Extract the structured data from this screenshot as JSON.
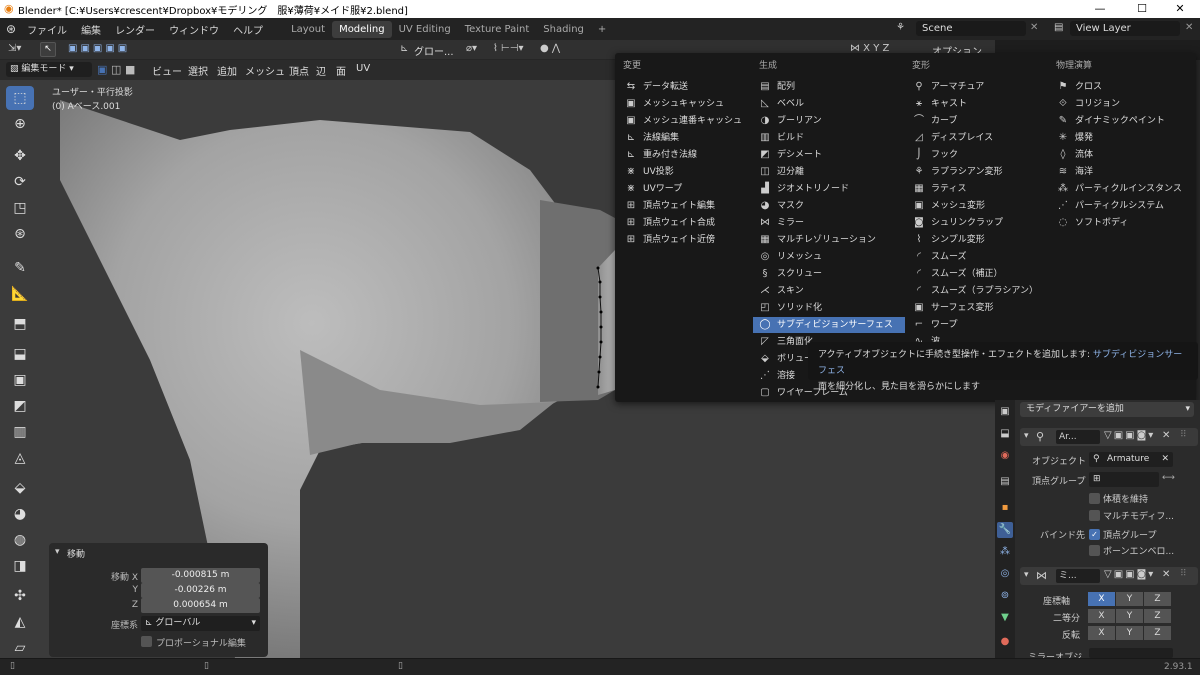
{
  "window": {
    "title": "Blender* [C:¥Users¥crescent¥Dropbox¥モデリング　服¥薄荷¥メイド服¥2.blend]",
    "minimize": "—",
    "maximize": "☐",
    "close": "✕"
  },
  "topbar": {
    "menus": [
      "ファイル",
      "編集",
      "レンダー",
      "ウィンドウ",
      "ヘルプ"
    ],
    "workspaces": [
      "Layout",
      "Modeling",
      "UV Editing",
      "Texture Paint",
      "Shading"
    ],
    "add_workspace": "+",
    "scene": "Scene",
    "view_layer": "View Layer"
  },
  "header": {
    "transform_orientation": "グロー...",
    "pivot_label": "オプション",
    "mode": "編集モード",
    "menus": [
      "ビュー",
      "選択",
      "追加",
      "メッシュ",
      "頂点",
      "辺",
      "面",
      "UV"
    ]
  },
  "viewport": {
    "view_name": "ユーザー・平行投影",
    "object_name": "(0) Aベース.001"
  },
  "move_panel": {
    "title": "移動",
    "x_label": "移動 X",
    "x_value": "-0.000815 m",
    "y_label": "Y",
    "y_value": "-0.00226 m",
    "z_label": "Z",
    "z_value": "0.000654 m",
    "coord_label": "座標系",
    "coord_value": "グローバル",
    "proportional_label": "プロポーショナル編集"
  },
  "add_menu": {
    "columns": [
      {
        "header": "変更",
        "items": [
          "データ転送",
          "メッシュキャッシュ",
          "メッシュ連番キャッシュ",
          "法線編集",
          "重み付き法線",
          "UV投影",
          "UVワープ",
          "頂点ウェイト編集",
          "頂点ウェイト合成",
          "頂点ウェイト近傍"
        ]
      },
      {
        "header": "生成",
        "items": [
          "配列",
          "ベベル",
          "ブーリアン",
          "ビルド",
          "デシメート",
          "辺分離",
          "ジオメトリノード",
          "マスク",
          "ミラー",
          "マルチレゾリューション",
          "リメッシュ",
          "スクリュー",
          "スキン",
          "ソリッド化",
          "サブディビジョンサーフェス",
          "三角面化",
          "ボリュー",
          "溶接",
          "ワイヤーフレーム"
        ]
      },
      {
        "header": "変形",
        "items": [
          "アーマチュア",
          "キャスト",
          "カーブ",
          "ディスプレイス",
          "フック",
          "ラプラシアン変形",
          "ラティス",
          "メッシュ変形",
          "シュリンクラップ",
          "シンプル変形",
          "スムーズ",
          "スムーズ（補正）",
          "スムーズ（ラプラシアン）",
          "サーフェス変形",
          "ワープ",
          "波"
        ]
      },
      {
        "header": "物理演算",
        "items": [
          "クロス",
          "コリジョン",
          "ダイナミックペイント",
          "爆発",
          "流体",
          "海洋",
          "パーティクルインスタンス",
          "パーティクルシステム",
          "ソフトボディ"
        ]
      }
    ],
    "highlighted": "サブディビジョンサーフェス"
  },
  "tooltip": {
    "line1": "アクティブオブジェクトに手続き型操作・エフェクトを追加します: ",
    "line1_target": "サブディビジョンサーフェス",
    "line2": "面を細分化し、見た目を滑らかにします"
  },
  "properties": {
    "add_modifier": "モディファイアーを追加",
    "mod1_name": "Ar...",
    "object_label": "オブジェクト",
    "object_value": "Armature",
    "vgroup_label": "頂点グループ",
    "preserve_volume": "体積を維持",
    "multi_modifier": "マルチモディフ...",
    "bind_label": "バインド先",
    "bind_vgroup": "頂点グループ",
    "bind_bone": "ボーンエンベロ...",
    "mod2_name": "ミ...",
    "axis_label": "座標軸",
    "bisect_label": "二等分",
    "flip_label": "反転",
    "x": "X",
    "y": "Y",
    "z": "Z",
    "mirror_object": "ミラーオブジ..."
  },
  "status": {
    "version": "2.93.1"
  },
  "colors": {
    "accent": "#4772b3",
    "menu_bg": "#181818",
    "viewport_bg": "#3b3b3b"
  }
}
